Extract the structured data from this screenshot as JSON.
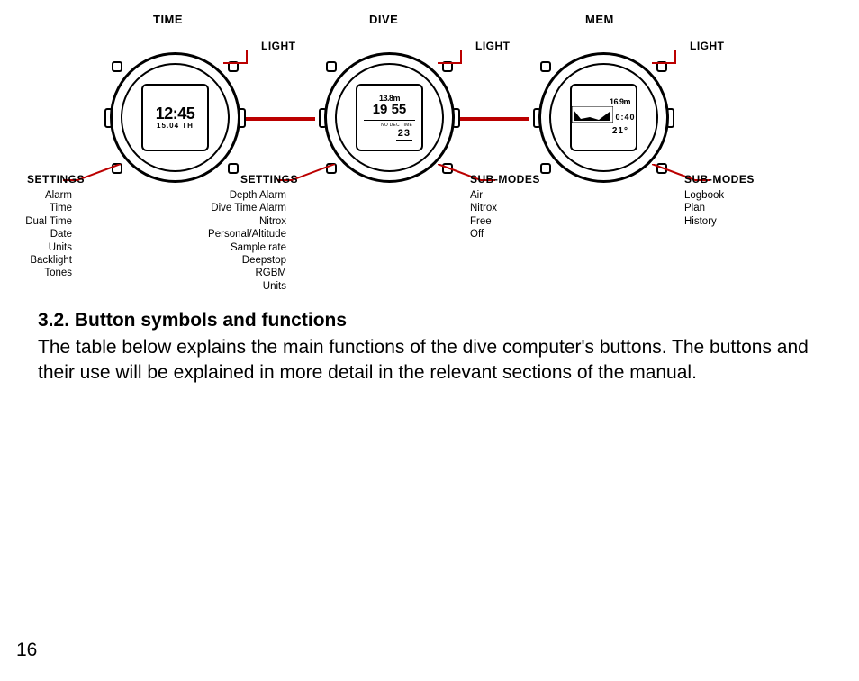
{
  "modes": {
    "time": {
      "title": "TIME",
      "light": "LIGHT",
      "bottomLabel": "SETTINGS",
      "items": [
        "Alarm",
        "Time",
        "Dual Time",
        "Date",
        "Units",
        "Backlight",
        "Tones"
      ],
      "screen": {
        "big": "12:45",
        "small": "15.04 TH"
      }
    },
    "dive": {
      "title": "DIVE",
      "light": "LIGHT",
      "bottomLabel": "SETTINGS",
      "items": [
        "Depth Alarm",
        "Dive Time Alarm",
        "Nitrox",
        "Personal/Altitude",
        "Sample rate",
        "Deepstop",
        "RGBM",
        "Units"
      ],
      "screen": {
        "top": "13.8m",
        "mid": "19   55",
        "tiny": "NO DEC TIME",
        "bottom": "23"
      }
    },
    "submodes1": {
      "title": "",
      "light": "LIGHT",
      "bottomLabel": "SUB-MODES",
      "items": [
        "Air",
        "Nitrox",
        "Free",
        "Off"
      ]
    },
    "mem": {
      "title": "MEM",
      "light": "LIGHT",
      "bottomLabel": "SUB-MODES",
      "items": [
        "Logbook",
        "Plan",
        "History"
      ],
      "screen": {
        "top": "16.9m",
        "side": "0:40",
        "bottom": "21°"
      }
    }
  },
  "section": {
    "heading": "3.2. Button symbols and functions",
    "paragraph": "The table below explains the main functions of the dive computer's buttons. The buttons and their use will be explained in more detail in the relevant sections of the manual."
  },
  "pageNumber": "16"
}
